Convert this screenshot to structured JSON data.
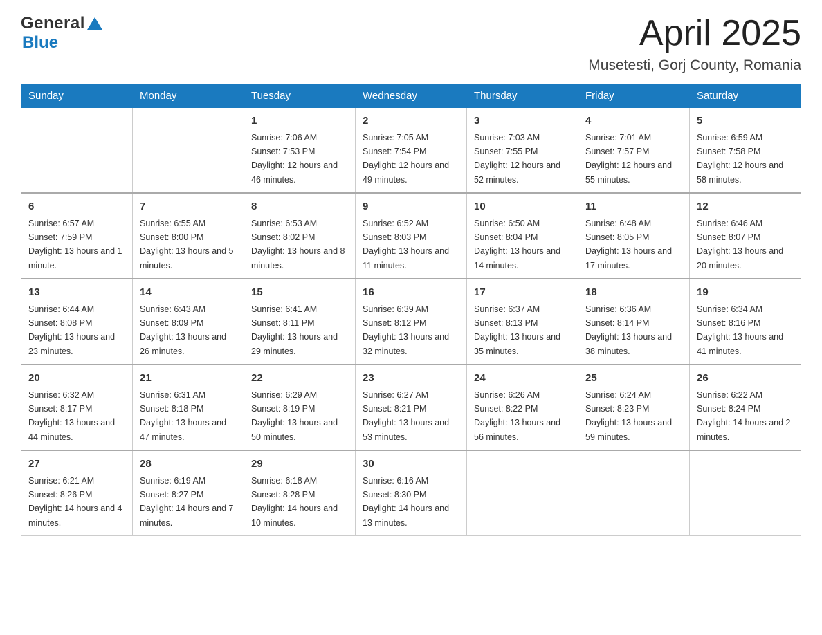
{
  "header": {
    "logo_general": "General",
    "logo_blue": "Blue",
    "month_year": "April 2025",
    "location": "Musetesti, Gorj County, Romania"
  },
  "days_of_week": [
    "Sunday",
    "Monday",
    "Tuesday",
    "Wednesday",
    "Thursday",
    "Friday",
    "Saturday"
  ],
  "weeks": [
    [
      {
        "day": "",
        "sunrise": "",
        "sunset": "",
        "daylight": ""
      },
      {
        "day": "",
        "sunrise": "",
        "sunset": "",
        "daylight": ""
      },
      {
        "day": "1",
        "sunrise": "Sunrise: 7:06 AM",
        "sunset": "Sunset: 7:53 PM",
        "daylight": "Daylight: 12 hours and 46 minutes."
      },
      {
        "day": "2",
        "sunrise": "Sunrise: 7:05 AM",
        "sunset": "Sunset: 7:54 PM",
        "daylight": "Daylight: 12 hours and 49 minutes."
      },
      {
        "day": "3",
        "sunrise": "Sunrise: 7:03 AM",
        "sunset": "Sunset: 7:55 PM",
        "daylight": "Daylight: 12 hours and 52 minutes."
      },
      {
        "day": "4",
        "sunrise": "Sunrise: 7:01 AM",
        "sunset": "Sunset: 7:57 PM",
        "daylight": "Daylight: 12 hours and 55 minutes."
      },
      {
        "day": "5",
        "sunrise": "Sunrise: 6:59 AM",
        "sunset": "Sunset: 7:58 PM",
        "daylight": "Daylight: 12 hours and 58 minutes."
      }
    ],
    [
      {
        "day": "6",
        "sunrise": "Sunrise: 6:57 AM",
        "sunset": "Sunset: 7:59 PM",
        "daylight": "Daylight: 13 hours and 1 minute."
      },
      {
        "day": "7",
        "sunrise": "Sunrise: 6:55 AM",
        "sunset": "Sunset: 8:00 PM",
        "daylight": "Daylight: 13 hours and 5 minutes."
      },
      {
        "day": "8",
        "sunrise": "Sunrise: 6:53 AM",
        "sunset": "Sunset: 8:02 PM",
        "daylight": "Daylight: 13 hours and 8 minutes."
      },
      {
        "day": "9",
        "sunrise": "Sunrise: 6:52 AM",
        "sunset": "Sunset: 8:03 PM",
        "daylight": "Daylight: 13 hours and 11 minutes."
      },
      {
        "day": "10",
        "sunrise": "Sunrise: 6:50 AM",
        "sunset": "Sunset: 8:04 PM",
        "daylight": "Daylight: 13 hours and 14 minutes."
      },
      {
        "day": "11",
        "sunrise": "Sunrise: 6:48 AM",
        "sunset": "Sunset: 8:05 PM",
        "daylight": "Daylight: 13 hours and 17 minutes."
      },
      {
        "day": "12",
        "sunrise": "Sunrise: 6:46 AM",
        "sunset": "Sunset: 8:07 PM",
        "daylight": "Daylight: 13 hours and 20 minutes."
      }
    ],
    [
      {
        "day": "13",
        "sunrise": "Sunrise: 6:44 AM",
        "sunset": "Sunset: 8:08 PM",
        "daylight": "Daylight: 13 hours and 23 minutes."
      },
      {
        "day": "14",
        "sunrise": "Sunrise: 6:43 AM",
        "sunset": "Sunset: 8:09 PM",
        "daylight": "Daylight: 13 hours and 26 minutes."
      },
      {
        "day": "15",
        "sunrise": "Sunrise: 6:41 AM",
        "sunset": "Sunset: 8:11 PM",
        "daylight": "Daylight: 13 hours and 29 minutes."
      },
      {
        "day": "16",
        "sunrise": "Sunrise: 6:39 AM",
        "sunset": "Sunset: 8:12 PM",
        "daylight": "Daylight: 13 hours and 32 minutes."
      },
      {
        "day": "17",
        "sunrise": "Sunrise: 6:37 AM",
        "sunset": "Sunset: 8:13 PM",
        "daylight": "Daylight: 13 hours and 35 minutes."
      },
      {
        "day": "18",
        "sunrise": "Sunrise: 6:36 AM",
        "sunset": "Sunset: 8:14 PM",
        "daylight": "Daylight: 13 hours and 38 minutes."
      },
      {
        "day": "19",
        "sunrise": "Sunrise: 6:34 AM",
        "sunset": "Sunset: 8:16 PM",
        "daylight": "Daylight: 13 hours and 41 minutes."
      }
    ],
    [
      {
        "day": "20",
        "sunrise": "Sunrise: 6:32 AM",
        "sunset": "Sunset: 8:17 PM",
        "daylight": "Daylight: 13 hours and 44 minutes."
      },
      {
        "day": "21",
        "sunrise": "Sunrise: 6:31 AM",
        "sunset": "Sunset: 8:18 PM",
        "daylight": "Daylight: 13 hours and 47 minutes."
      },
      {
        "day": "22",
        "sunrise": "Sunrise: 6:29 AM",
        "sunset": "Sunset: 8:19 PM",
        "daylight": "Daylight: 13 hours and 50 minutes."
      },
      {
        "day": "23",
        "sunrise": "Sunrise: 6:27 AM",
        "sunset": "Sunset: 8:21 PM",
        "daylight": "Daylight: 13 hours and 53 minutes."
      },
      {
        "day": "24",
        "sunrise": "Sunrise: 6:26 AM",
        "sunset": "Sunset: 8:22 PM",
        "daylight": "Daylight: 13 hours and 56 minutes."
      },
      {
        "day": "25",
        "sunrise": "Sunrise: 6:24 AM",
        "sunset": "Sunset: 8:23 PM",
        "daylight": "Daylight: 13 hours and 59 minutes."
      },
      {
        "day": "26",
        "sunrise": "Sunrise: 6:22 AM",
        "sunset": "Sunset: 8:24 PM",
        "daylight": "Daylight: 14 hours and 2 minutes."
      }
    ],
    [
      {
        "day": "27",
        "sunrise": "Sunrise: 6:21 AM",
        "sunset": "Sunset: 8:26 PM",
        "daylight": "Daylight: 14 hours and 4 minutes."
      },
      {
        "day": "28",
        "sunrise": "Sunrise: 6:19 AM",
        "sunset": "Sunset: 8:27 PM",
        "daylight": "Daylight: 14 hours and 7 minutes."
      },
      {
        "day": "29",
        "sunrise": "Sunrise: 6:18 AM",
        "sunset": "Sunset: 8:28 PM",
        "daylight": "Daylight: 14 hours and 10 minutes."
      },
      {
        "day": "30",
        "sunrise": "Sunrise: 6:16 AM",
        "sunset": "Sunset: 8:30 PM",
        "daylight": "Daylight: 14 hours and 13 minutes."
      },
      {
        "day": "",
        "sunrise": "",
        "sunset": "",
        "daylight": ""
      },
      {
        "day": "",
        "sunrise": "",
        "sunset": "",
        "daylight": ""
      },
      {
        "day": "",
        "sunrise": "",
        "sunset": "",
        "daylight": ""
      }
    ]
  ]
}
